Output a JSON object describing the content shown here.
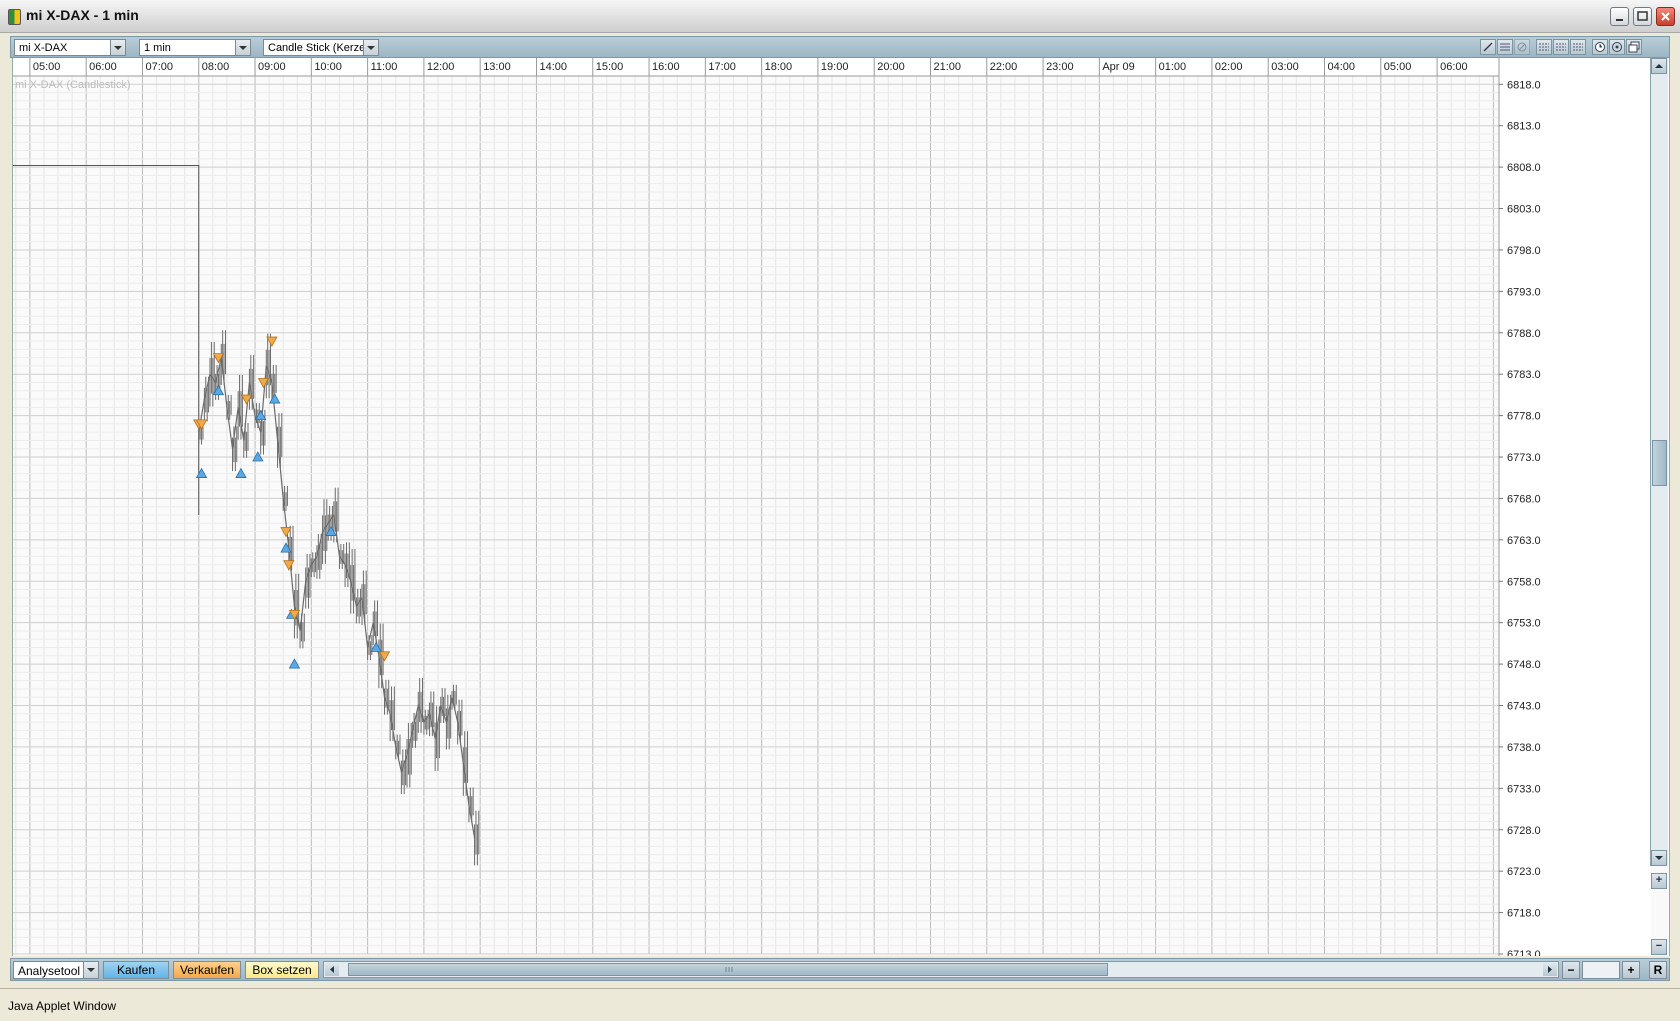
{
  "window": {
    "title": "mi X-DAX - 1 min"
  },
  "toolbar": {
    "instrument": "mi X-DAX",
    "interval": "1 min",
    "chart_style": "Candle Stick (Kerzen"
  },
  "chart": {
    "series_label": "mi X-DAX (Candlestick)"
  },
  "chart_data": {
    "type": "line",
    "x_ticks": [
      "05:00",
      "06:00",
      "07:00",
      "08:00",
      "09:00",
      "10:00",
      "11:00",
      "12:00",
      "13:00",
      "14:00",
      "15:00",
      "16:00",
      "17:00",
      "18:00",
      "19:00",
      "20:00",
      "21:00",
      "22:00",
      "23:00",
      "Apr 09",
      "01:00",
      "02:00",
      "03:00",
      "04:00",
      "05:00",
      "06:00"
    ],
    "y_ticks": [
      "6818.0",
      "6813.0",
      "6808.0",
      "6803.0",
      "6798.0",
      "6793.0",
      "6788.0",
      "6783.0",
      "6778.0",
      "6773.0",
      "6768.0",
      "6763.0",
      "6758.0",
      "6753.0",
      "6748.0",
      "6743.0",
      "6738.0",
      "6733.0",
      "6728.0",
      "6723.0",
      "6718.0",
      "6713.0"
    ],
    "x_range_hours": [
      4.7,
      31.1
    ],
    "ylim": [
      6713,
      6819
    ],
    "prev_close_line": {
      "value": 6808.2,
      "from": 4.7,
      "to": 8.0
    },
    "price_series": {
      "x": [
        8.0,
        8.1,
        8.2,
        8.3,
        8.4,
        8.5,
        8.6,
        8.7,
        8.8,
        8.9,
        9.0,
        9.1,
        9.2,
        9.3,
        9.4,
        9.5,
        9.6,
        9.7,
        9.8,
        9.9,
        10.0,
        10.1,
        10.2,
        10.3,
        10.4,
        10.5,
        10.6,
        10.7,
        10.8,
        10.9,
        11.0,
        11.1,
        11.2,
        11.3,
        11.4,
        11.5,
        11.6,
        11.7,
        11.8,
        11.9,
        12.0,
        12.1,
        12.2,
        12.3,
        12.4,
        12.5,
        12.6,
        12.7,
        12.8,
        12.9
      ],
      "y": [
        6776,
        6780,
        6783,
        6782,
        6785,
        6779,
        6774,
        6779,
        6775,
        6782,
        6778,
        6776,
        6784,
        6782,
        6775,
        6768,
        6762,
        6755,
        6752,
        6758,
        6760,
        6761,
        6764,
        6765,
        6766,
        6761,
        6760,
        6758,
        6755,
        6756,
        6750,
        6753,
        6749,
        6744,
        6742,
        6738,
        6735,
        6737,
        6740,
        6743,
        6741,
        6742,
        6739,
        6743,
        6741,
        6744,
        6741,
        6736,
        6731,
        6727
      ]
    },
    "buy_markers": [
      {
        "x": 8.05,
        "y": 6771
      },
      {
        "x": 8.35,
        "y": 6781
      },
      {
        "x": 8.75,
        "y": 6771
      },
      {
        "x": 9.05,
        "y": 6773
      },
      {
        "x": 9.1,
        "y": 6778
      },
      {
        "x": 9.35,
        "y": 6780
      },
      {
        "x": 9.55,
        "y": 6762
      },
      {
        "x": 9.65,
        "y": 6754
      },
      {
        "x": 9.7,
        "y": 6748
      },
      {
        "x": 10.35,
        "y": 6764
      },
      {
        "x": 11.15,
        "y": 6750
      }
    ],
    "sell_markers": [
      {
        "x": 8.0,
        "y": 6777
      },
      {
        "x": 8.05,
        "y": 6777
      },
      {
        "x": 8.35,
        "y": 6785
      },
      {
        "x": 8.85,
        "y": 6780
      },
      {
        "x": 9.15,
        "y": 6782
      },
      {
        "x": 9.3,
        "y": 6787
      },
      {
        "x": 9.55,
        "y": 6764
      },
      {
        "x": 9.6,
        "y": 6760
      },
      {
        "x": 9.7,
        "y": 6754
      },
      {
        "x": 11.3,
        "y": 6749
      }
    ]
  },
  "bottombar": {
    "tool_select": "Analysetool",
    "buy": "Kaufen",
    "sell": "Verkaufen",
    "box": "Box setzen"
  },
  "zoom": {
    "out": "−",
    "in": "+",
    "reset": "R"
  },
  "status": {
    "text": "Java Applet Window"
  },
  "colors": {
    "buy": "#5aa9e6",
    "sell": "#f2a94e",
    "price": "#6b6b6b",
    "grid": "#d3d3d3"
  }
}
